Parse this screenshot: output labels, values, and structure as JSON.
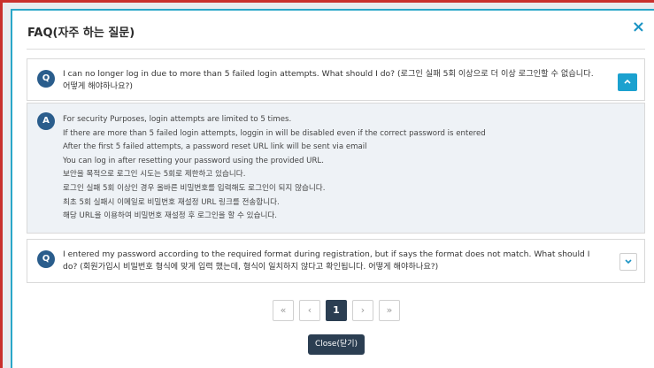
{
  "modal": {
    "title": "FAQ(자주 하는 질문)",
    "close_icon": "×"
  },
  "faq": [
    {
      "badge": "Q",
      "question": "I can no longer log in due to more than 5 failed login attempts. What should I do? (로그인 실패 5회 이상으로 더 이상 로그인할 수 없습니다. 어떻게 해야하나요?)",
      "expanded": true,
      "toggle_icon": "chevron-up-icon",
      "answer_badge": "A",
      "answer_lines": [
        "For security Purposes, login attempts are limited to 5 times.",
        "If there are more than 5 failed login attempts, loggin in will be disabled even if the correct password is entered",
        "After the first 5 failed attempts, a password reset URL link will be sent via email",
        "You can log in after resetting your password using the provided URL.",
        "보안을 목적으로 로그인 시도는 5회로 제한하고 있습니다.",
        "로그인 실패 5회 이상인 경우 올바른 비밀번호를 입력해도 로그인이 되지 않습니다.",
        "최초 5회 실패시 이메일로 비밀번호 재설정 URL 링크를 전송합니다.",
        "해당 URL을 이용하여 비밀번호 재설정 후 로그인을 할 수 있습니다."
      ]
    },
    {
      "badge": "Q",
      "question": "I entered my password according to the required format during registration, but if says the format does not match. What should I do? (회원가입시 비밀번호 형식에 맞게 입력 했는데, 형식이 일치하지 않다고 확인됩니다. 어떻게 해야하나요?)",
      "expanded": false,
      "toggle_icon": "chevron-down-icon"
    }
  ],
  "pagination": {
    "first": "«",
    "prev": "‹",
    "current": "1",
    "next": "›",
    "last": "»"
  },
  "footer": {
    "close_label": "Close(닫기)"
  },
  "colors": {
    "accent": "#1ba1cf",
    "dark": "#2b3e52",
    "badge": "#2a5d8c",
    "answer_bg": "#eef2f6"
  }
}
